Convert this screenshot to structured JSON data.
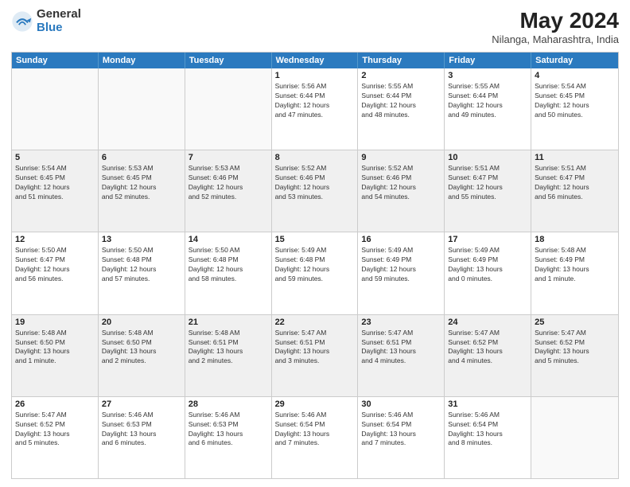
{
  "logo": {
    "general": "General",
    "blue": "Blue"
  },
  "title": "May 2024",
  "subtitle": "Nilanga, Maharashtra, India",
  "header_days": [
    "Sunday",
    "Monday",
    "Tuesday",
    "Wednesday",
    "Thursday",
    "Friday",
    "Saturday"
  ],
  "weeks": [
    [
      {
        "day": "",
        "info": "",
        "empty": true
      },
      {
        "day": "",
        "info": "",
        "empty": true
      },
      {
        "day": "",
        "info": "",
        "empty": true
      },
      {
        "day": "1",
        "info": "Sunrise: 5:56 AM\nSunset: 6:44 PM\nDaylight: 12 hours\nand 47 minutes."
      },
      {
        "day": "2",
        "info": "Sunrise: 5:55 AM\nSunset: 6:44 PM\nDaylight: 12 hours\nand 48 minutes."
      },
      {
        "day": "3",
        "info": "Sunrise: 5:55 AM\nSunset: 6:44 PM\nDaylight: 12 hours\nand 49 minutes."
      },
      {
        "day": "4",
        "info": "Sunrise: 5:54 AM\nSunset: 6:45 PM\nDaylight: 12 hours\nand 50 minutes."
      }
    ],
    [
      {
        "day": "5",
        "info": "Sunrise: 5:54 AM\nSunset: 6:45 PM\nDaylight: 12 hours\nand 51 minutes."
      },
      {
        "day": "6",
        "info": "Sunrise: 5:53 AM\nSunset: 6:45 PM\nDaylight: 12 hours\nand 52 minutes."
      },
      {
        "day": "7",
        "info": "Sunrise: 5:53 AM\nSunset: 6:46 PM\nDaylight: 12 hours\nand 52 minutes."
      },
      {
        "day": "8",
        "info": "Sunrise: 5:52 AM\nSunset: 6:46 PM\nDaylight: 12 hours\nand 53 minutes."
      },
      {
        "day": "9",
        "info": "Sunrise: 5:52 AM\nSunset: 6:46 PM\nDaylight: 12 hours\nand 54 minutes."
      },
      {
        "day": "10",
        "info": "Sunrise: 5:51 AM\nSunset: 6:47 PM\nDaylight: 12 hours\nand 55 minutes."
      },
      {
        "day": "11",
        "info": "Sunrise: 5:51 AM\nSunset: 6:47 PM\nDaylight: 12 hours\nand 56 minutes."
      }
    ],
    [
      {
        "day": "12",
        "info": "Sunrise: 5:50 AM\nSunset: 6:47 PM\nDaylight: 12 hours\nand 56 minutes."
      },
      {
        "day": "13",
        "info": "Sunrise: 5:50 AM\nSunset: 6:48 PM\nDaylight: 12 hours\nand 57 minutes."
      },
      {
        "day": "14",
        "info": "Sunrise: 5:50 AM\nSunset: 6:48 PM\nDaylight: 12 hours\nand 58 minutes."
      },
      {
        "day": "15",
        "info": "Sunrise: 5:49 AM\nSunset: 6:48 PM\nDaylight: 12 hours\nand 59 minutes."
      },
      {
        "day": "16",
        "info": "Sunrise: 5:49 AM\nSunset: 6:49 PM\nDaylight: 12 hours\nand 59 minutes."
      },
      {
        "day": "17",
        "info": "Sunrise: 5:49 AM\nSunset: 6:49 PM\nDaylight: 13 hours\nand 0 minutes."
      },
      {
        "day": "18",
        "info": "Sunrise: 5:48 AM\nSunset: 6:49 PM\nDaylight: 13 hours\nand 1 minute."
      }
    ],
    [
      {
        "day": "19",
        "info": "Sunrise: 5:48 AM\nSunset: 6:50 PM\nDaylight: 13 hours\nand 1 minute."
      },
      {
        "day": "20",
        "info": "Sunrise: 5:48 AM\nSunset: 6:50 PM\nDaylight: 13 hours\nand 2 minutes."
      },
      {
        "day": "21",
        "info": "Sunrise: 5:48 AM\nSunset: 6:51 PM\nDaylight: 13 hours\nand 2 minutes."
      },
      {
        "day": "22",
        "info": "Sunrise: 5:47 AM\nSunset: 6:51 PM\nDaylight: 13 hours\nand 3 minutes."
      },
      {
        "day": "23",
        "info": "Sunrise: 5:47 AM\nSunset: 6:51 PM\nDaylight: 13 hours\nand 4 minutes."
      },
      {
        "day": "24",
        "info": "Sunrise: 5:47 AM\nSunset: 6:52 PM\nDaylight: 13 hours\nand 4 minutes."
      },
      {
        "day": "25",
        "info": "Sunrise: 5:47 AM\nSunset: 6:52 PM\nDaylight: 13 hours\nand 5 minutes."
      }
    ],
    [
      {
        "day": "26",
        "info": "Sunrise: 5:47 AM\nSunset: 6:52 PM\nDaylight: 13 hours\nand 5 minutes."
      },
      {
        "day": "27",
        "info": "Sunrise: 5:46 AM\nSunset: 6:53 PM\nDaylight: 13 hours\nand 6 minutes."
      },
      {
        "day": "28",
        "info": "Sunrise: 5:46 AM\nSunset: 6:53 PM\nDaylight: 13 hours\nand 6 minutes."
      },
      {
        "day": "29",
        "info": "Sunrise: 5:46 AM\nSunset: 6:54 PM\nDaylight: 13 hours\nand 7 minutes."
      },
      {
        "day": "30",
        "info": "Sunrise: 5:46 AM\nSunset: 6:54 PM\nDaylight: 13 hours\nand 7 minutes."
      },
      {
        "day": "31",
        "info": "Sunrise: 5:46 AM\nSunset: 6:54 PM\nDaylight: 13 hours\nand 8 minutes."
      },
      {
        "day": "",
        "info": "",
        "empty": true
      }
    ]
  ]
}
